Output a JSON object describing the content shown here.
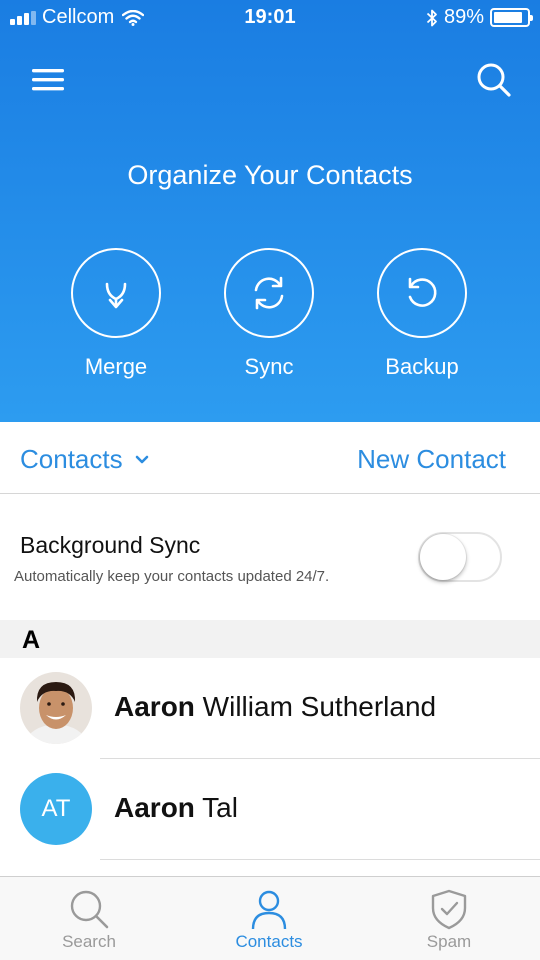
{
  "status_bar": {
    "carrier": "Cellcom",
    "time": "19:01",
    "battery": "89%",
    "battery_level": 0.89
  },
  "header": {
    "title": "Organize Your Contacts",
    "actions": [
      {
        "label": "Merge",
        "icon": "merge-icon"
      },
      {
        "label": "Sync",
        "icon": "sync-icon"
      },
      {
        "label": "Backup",
        "icon": "backup-icon"
      }
    ]
  },
  "contacts_bar": {
    "dropdown_label": "Contacts",
    "new_contact_label": "New Contact"
  },
  "background_sync": {
    "title": "Background Sync",
    "description": "Automatically keep your contacts updated 24/7.",
    "enabled": false
  },
  "contact_list": {
    "section": "A",
    "contacts": [
      {
        "first": "Aaron",
        "rest": " William Sutherland",
        "avatar": "photo"
      },
      {
        "first": "Aaron",
        "rest": " Tal",
        "avatar": "initials",
        "initials": "AT"
      }
    ]
  },
  "tab_bar": {
    "tabs": [
      {
        "label": "Search",
        "icon": "search-icon"
      },
      {
        "label": "Contacts",
        "icon": "person-icon",
        "active": true
      },
      {
        "label": "Spam",
        "icon": "shield-check-icon"
      }
    ]
  },
  "colors": {
    "header_top": "#1a7de2",
    "header_bottom": "#2d9cf0",
    "accent": "#2c8de0",
    "avatar_blue": "#3ab0ec"
  }
}
